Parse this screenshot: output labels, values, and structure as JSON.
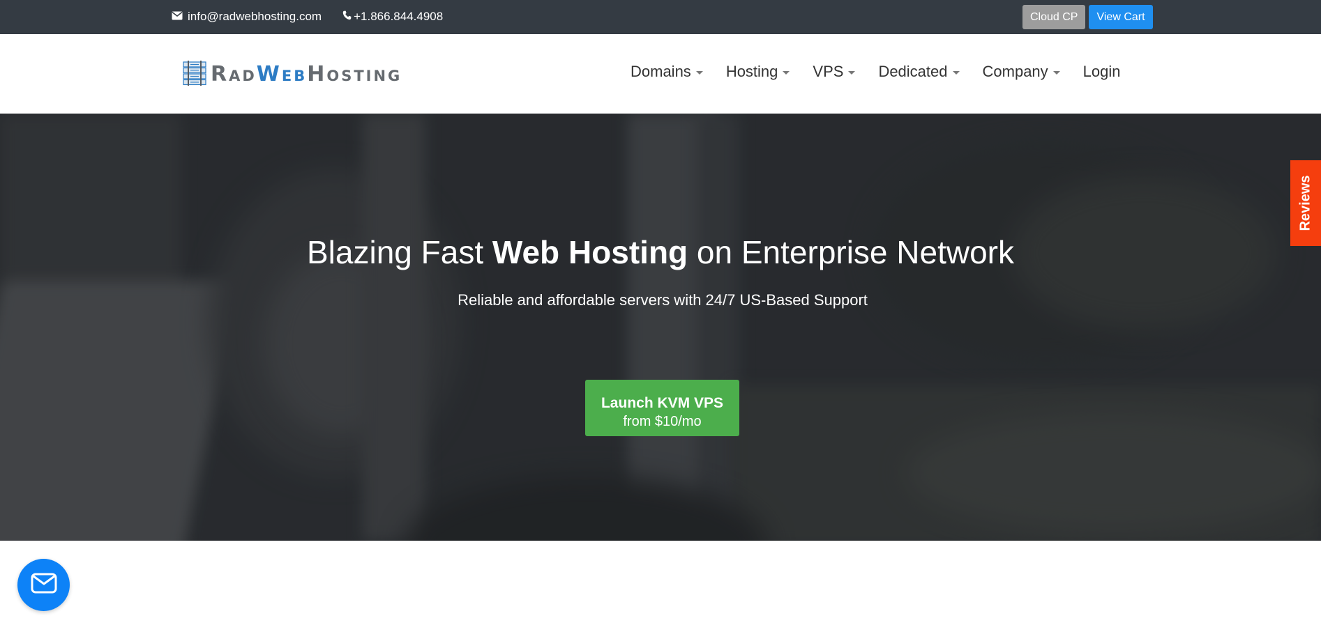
{
  "topbar": {
    "email": "info@radwebhosting.com",
    "email_icon": "envelope-icon",
    "phone": "+1.866.844.4908",
    "phone_icon": "phone-icon",
    "cloud_cp_label": "Cloud CP",
    "view_cart_label": "View Cart"
  },
  "logo": {
    "rad_first": "R",
    "rad_rest": "AD",
    "web_first": "W",
    "web_rest": "EB",
    "hosting_first": "H",
    "hosting_rest": "OSTING",
    "icon": "server-rack-icon"
  },
  "nav": {
    "items": [
      {
        "label": "Domains",
        "dropdown": true
      },
      {
        "label": "Hosting",
        "dropdown": true
      },
      {
        "label": "VPS",
        "dropdown": true
      },
      {
        "label": "Dedicated",
        "dropdown": true
      },
      {
        "label": "Company",
        "dropdown": true
      },
      {
        "label": "Login",
        "dropdown": false
      }
    ]
  },
  "hero": {
    "title_part1": "Blazing Fast ",
    "title_bold": "Web Hosting",
    "title_part2": " on Enterprise Network",
    "subtitle": "Reliable and affordable servers with 24/7 US-Based Support",
    "cta_line1": "Launch KVM VPS",
    "cta_line2": "from $10/mo"
  },
  "reviews_tab": {
    "label": "Reviews"
  },
  "chat": {
    "icon": "mail-icon"
  },
  "colors": {
    "topbar_bg": "#343b43",
    "cloud_cp_bg": "#9d9d9d",
    "view_cart_bg": "#1f8ff0",
    "logo_accent": "#2d7cc4",
    "cta_bg": "#4cae4c",
    "reviews_bg": "#f53e0e",
    "chat_bg": "#0d82f7"
  }
}
